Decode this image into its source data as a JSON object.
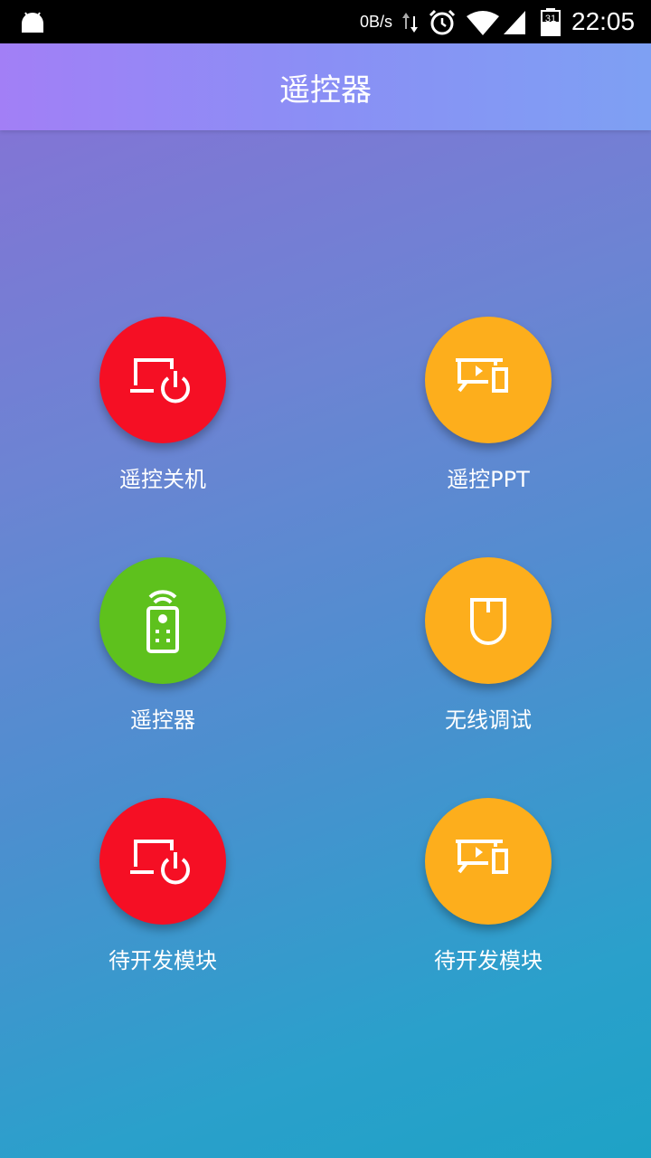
{
  "status_bar": {
    "net_speed": "0B/s",
    "battery_level": "31",
    "time": "22:05"
  },
  "app_bar": {
    "title": "遥控器"
  },
  "grid": {
    "items": [
      {
        "label": "遥控关机",
        "icon": "laptop-power-icon",
        "color": "#f50f24"
      },
      {
        "label": "遥控PPT",
        "icon": "presentation-phone-icon",
        "color": "#fdae1c"
      },
      {
        "label": "遥控器",
        "icon": "remote-control-icon",
        "color": "#5ec11d"
      },
      {
        "label": "无线调试",
        "icon": "mouse-icon",
        "color": "#fdae1c"
      },
      {
        "label": "待开发模块",
        "icon": "laptop-power-icon",
        "color": "#f50f24"
      },
      {
        "label": "待开发模块",
        "icon": "presentation-phone-icon",
        "color": "#fdae1c"
      }
    ]
  }
}
